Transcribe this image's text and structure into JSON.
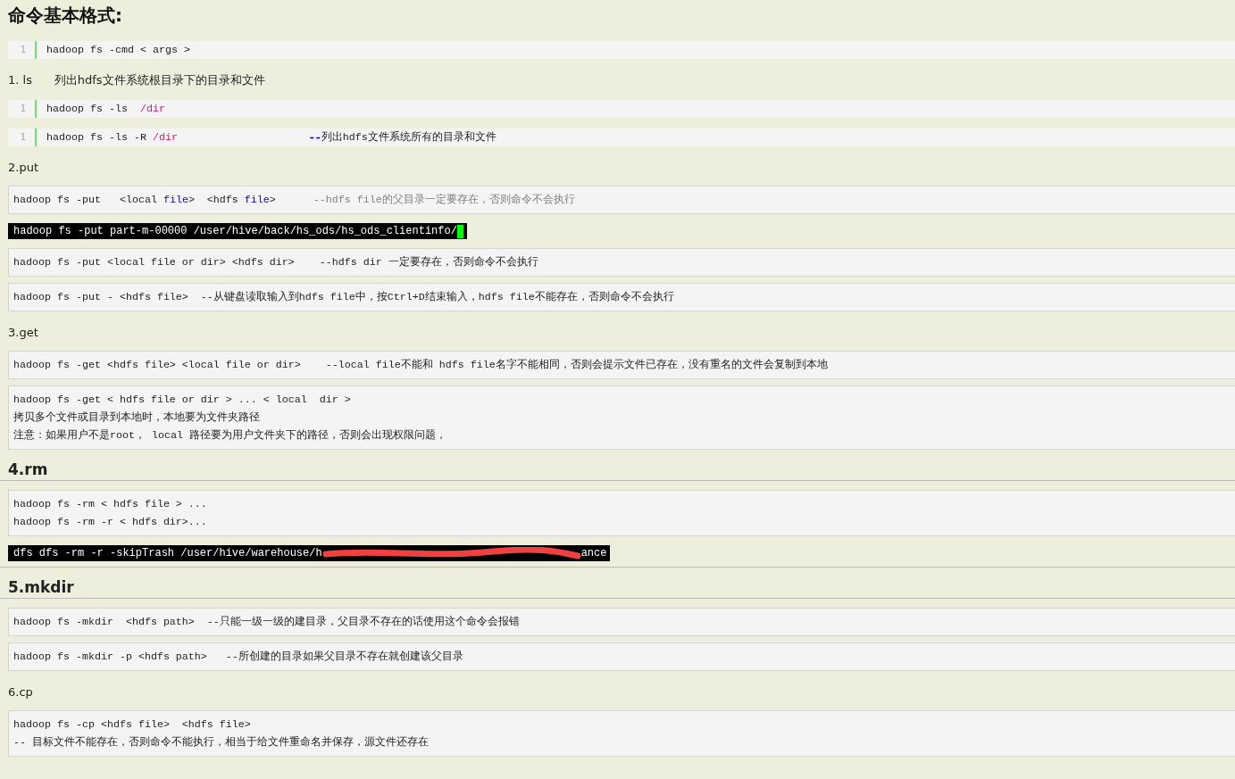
{
  "blocks": [
    {
      "kind": "title",
      "text": "命令基本格式:"
    },
    {
      "kind": "numbered",
      "number": "1",
      "segments": [
        {
          "text": "hadoop fs -cmd < args >"
        }
      ]
    },
    {
      "kind": "label",
      "text": "1. ls      列出hdfs文件系统根目录下的目录和文件"
    },
    {
      "kind": "numbered",
      "number": "1",
      "segments": [
        {
          "text": "hadoop fs -ls  "
        },
        {
          "text": "/dir",
          "color": "#d4137e"
        }
      ]
    },
    {
      "kind": "numbered",
      "number": "1",
      "segments": [
        {
          "text": "hadoop fs -ls -R "
        },
        {
          "text": "/dir",
          "color": "#d4137e"
        },
        {
          "text": "--",
          "color": "#0000ff"
        },
        {
          "text": "列出hdfs文件系统所有的目录和文件"
        }
      ]
    },
    {
      "kind": "label",
      "text": "2.put"
    },
    {
      "kind": "box",
      "lines": [
        [
          {
            "text": "hadoop fs -put   <local "
          },
          {
            "text": "file",
            "color": "#0000ff"
          },
          {
            "text": ">  <hdfs "
          },
          {
            "text": "file",
            "color": "#0000ff"
          },
          {
            "text": ">"
          },
          {
            "text": "      --hdfs file的父目录一定要存在，否则命令不会执行",
            "color": "#808080"
          }
        ]
      ]
    },
    {
      "kind": "terminal",
      "cursor": true,
      "text": "hadoop fs -put part-m-00000 /user/hive/back/hs_ods/hs_ods_clientinfo/"
    },
    {
      "kind": "box",
      "lines": [
        [
          {
            "text": "hadoop fs -put <local file or dir> <hdfs dir>    --hdfs dir 一定要存在，否则命令不会执行"
          }
        ]
      ]
    },
    {
      "kind": "box",
      "lines": [
        [
          {
            "text": "hadoop fs -put - <hdfs file>  --从键盘读取输入到hdfs file中，按Ctrl+D结束输入，hdfs file不能存在，否则命令不会执行"
          }
        ]
      ]
    },
    {
      "kind": "label",
      "text": "3.get"
    },
    {
      "kind": "box",
      "lines": [
        [
          {
            "text": "hadoop fs -get <hdfs file> <local file or dir>    --local file不能和 hdfs file名字不能相同，否则会提示文件已存在，没有重名的文件会复制到本地"
          }
        ]
      ]
    },
    {
      "kind": "box",
      "lines": [
        [
          {
            "text": "hadoop fs -get < hdfs file or dir > ... < local  dir >"
          }
        ],
        [
          {
            "text": "拷贝多个文件或目录到本地时，本地要为文件夹路径"
          }
        ],
        [
          {
            "text": "注意：如果用户不是root， local 路径要为用户文件夹下的路径，否则会出现权限问题，"
          }
        ]
      ]
    },
    {
      "kind": "section",
      "text": "4.rm"
    },
    {
      "kind": "box",
      "lines": [
        [
          {
            "text": "hadoop fs -rm < hdfs file > ..."
          }
        ],
        [
          {
            "text": "hadoop fs -rm -r < hdfs dir>..."
          }
        ]
      ]
    },
    {
      "kind": "terminal",
      "redacted": true,
      "text": "dfs dfs -rm -r -skipTrash /user/hive/warehouse/h",
      "text_after": "ance"
    },
    {
      "kind": "rule"
    },
    {
      "kind": "section",
      "text": "5.mkdir"
    },
    {
      "kind": "box",
      "lines": [
        [
          {
            "text": "hadoop fs -mkdir  <hdfs path>  --只能一级一级的建目录，父目录不存在的话使用这个命令会报错"
          }
        ]
      ]
    },
    {
      "kind": "box",
      "lines": [
        [
          {
            "text": "hadoop fs -mkdir -p <hdfs path>   --所创建的目录如果父目录不存在就创建该父目录"
          }
        ]
      ]
    },
    {
      "kind": "label",
      "text": "6.cp"
    },
    {
      "kind": "box",
      "lines": [
        [
          {
            "text": "hadoop fs -cp <hdfs file>  <hdfs file>"
          }
        ],
        [
          {
            "text": "-- 目标文件不能存在，否则命令不能执行，相当于给文件重命名并保存，源文件还存在"
          }
        ]
      ]
    }
  ]
}
